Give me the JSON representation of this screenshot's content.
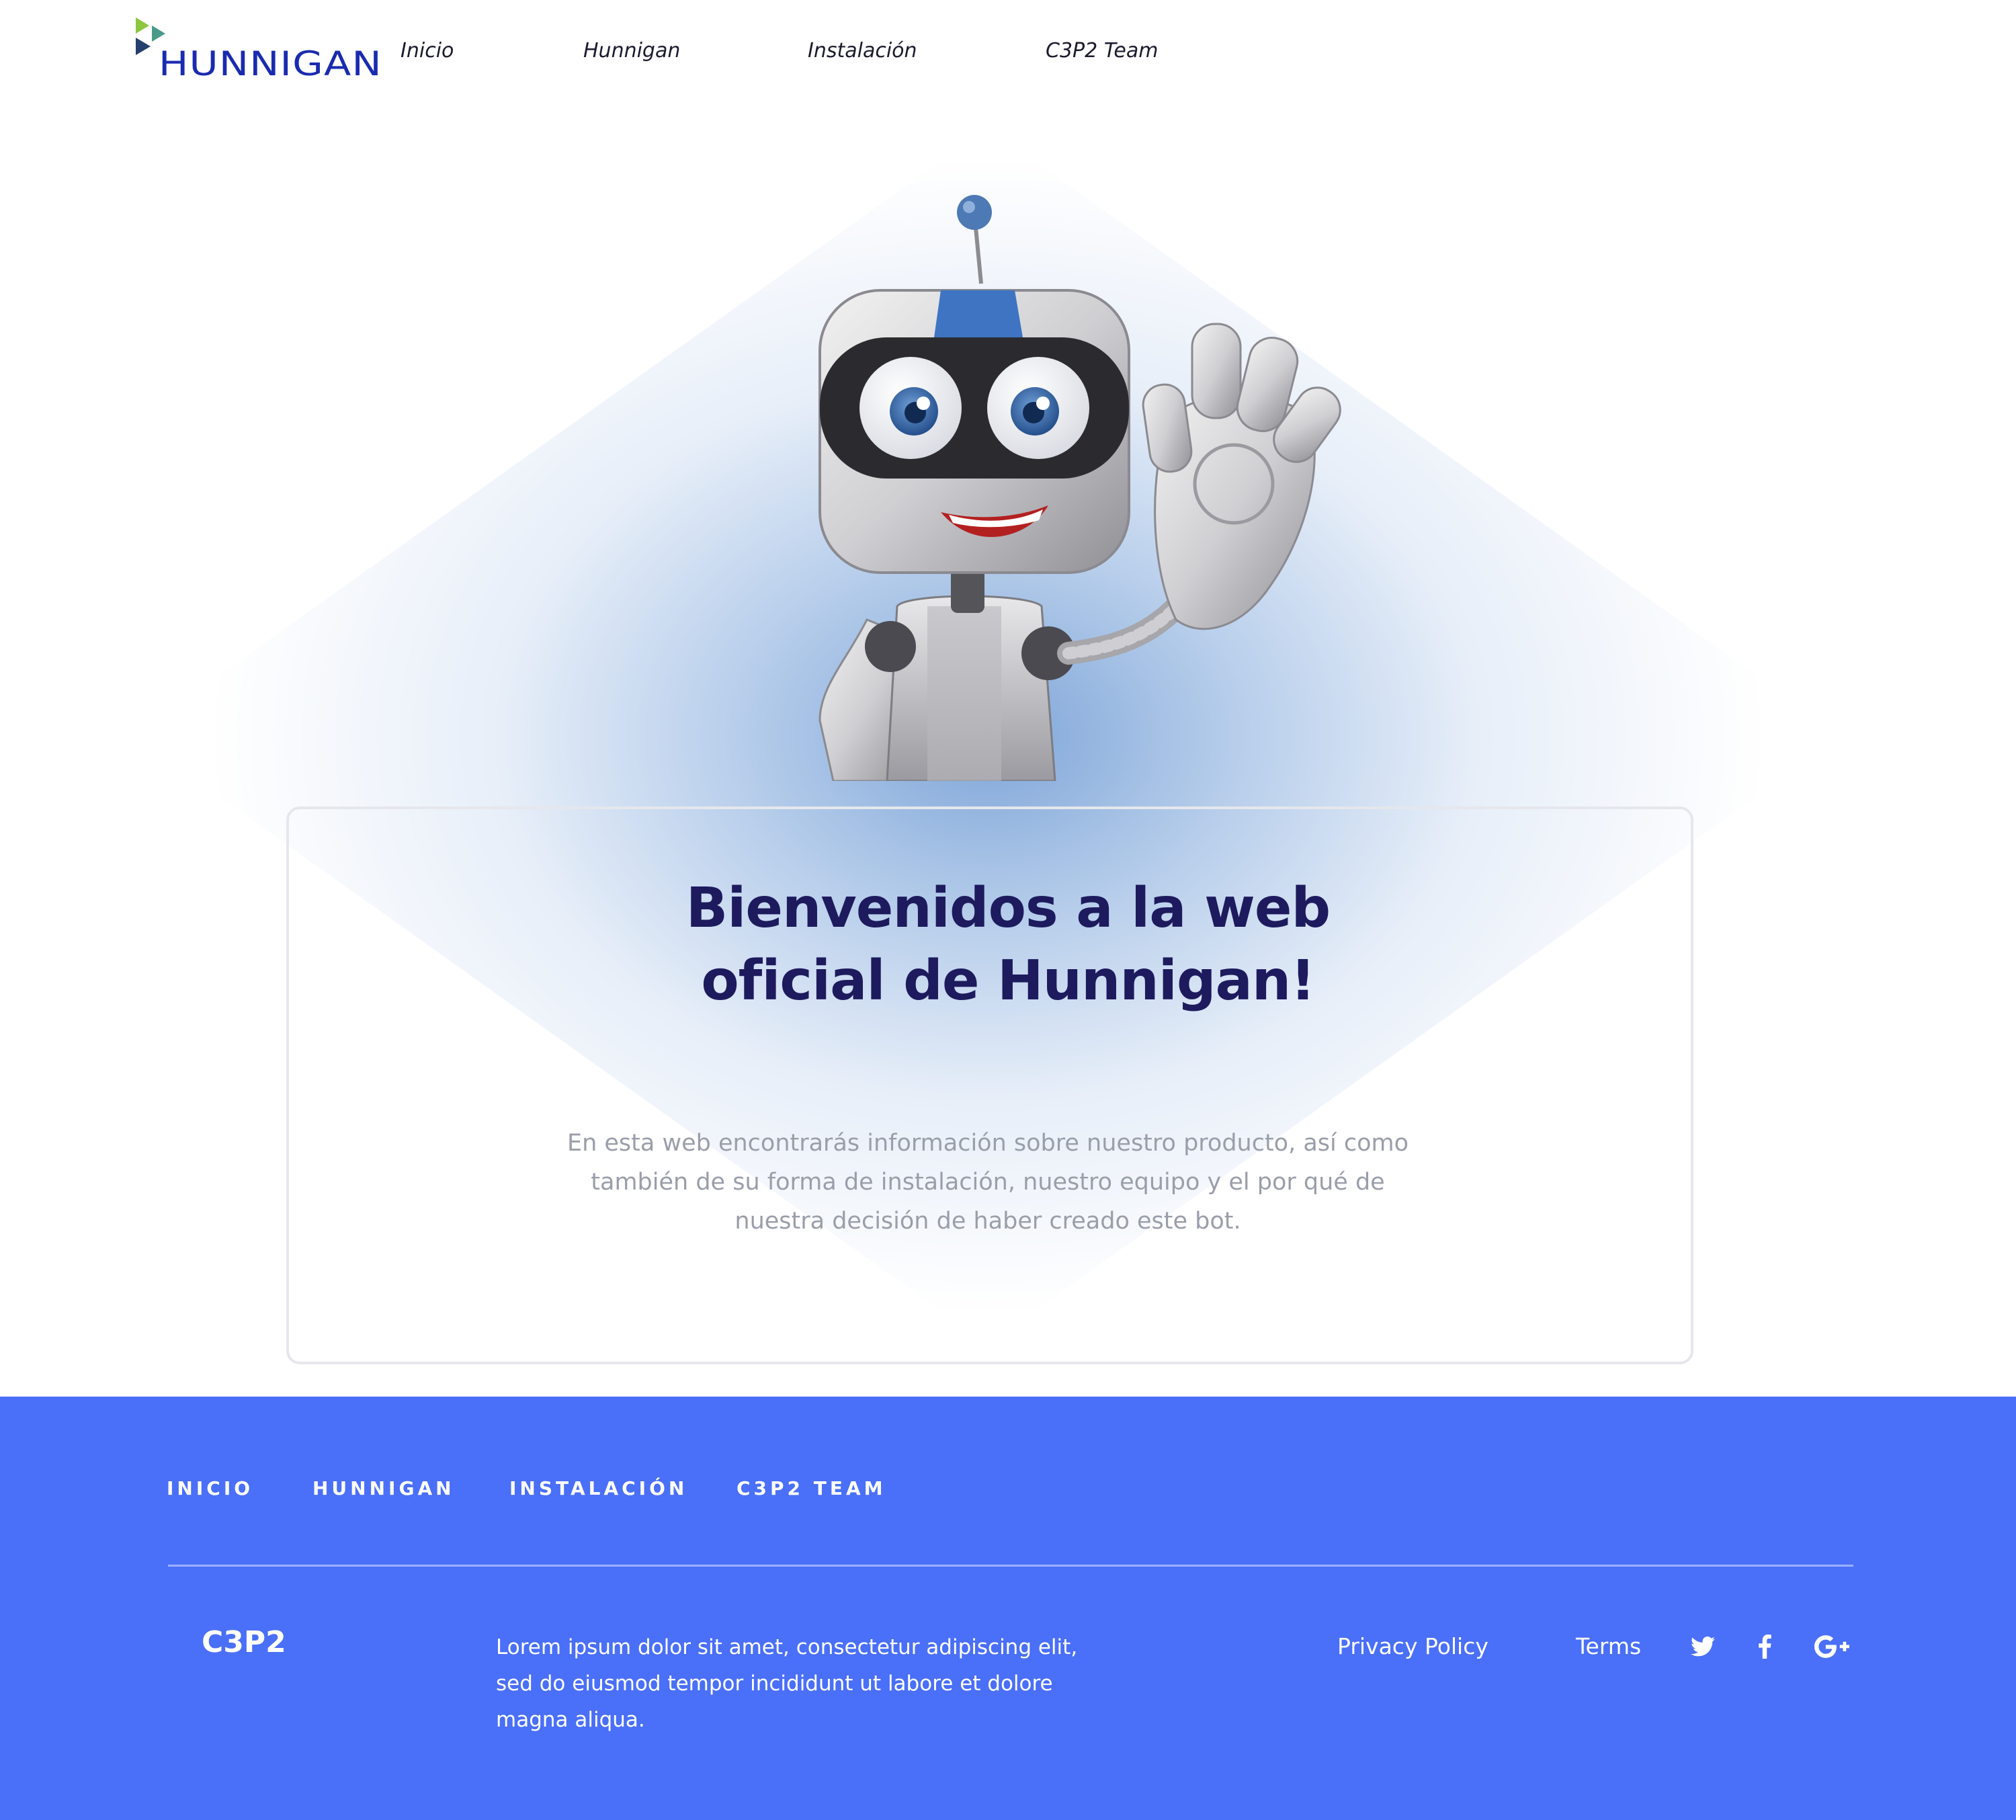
{
  "header": {
    "logo_text": "HUNNIGAN",
    "nav": [
      "Inicio",
      "Hunnigan",
      "Instalación",
      "C3P2 Team"
    ]
  },
  "hero": {
    "title_line1": "Bienvenidos a la web",
    "title_line2": "oficial de Hunnigan!",
    "description": "En esta web encontrarás información sobre nuestro producto, así como también de su forma de instalación, nuestro equipo y el por qué de nuestra decisión de haber creado este bot."
  },
  "footer": {
    "nav": [
      "INICIO",
      "HUNNIGAN",
      "INSTALACIÓN",
      "C3P2 TEAM"
    ],
    "brand": "C3P2",
    "text": "Lorem ipsum dolor sit amet, consectetur adipiscing elit, sed do eiusmod tempor incididunt ut labore et dolore magna aliqua.",
    "privacy": "Privacy Policy",
    "terms": "Terms",
    "social_icons": [
      "twitter-icon",
      "facebook-icon",
      "google-plus-icon"
    ]
  },
  "colors": {
    "logo_blue": "#1a2bb0",
    "logo_green": "#8dc63f",
    "title": "#1d1a5e",
    "description": "#9a9eaa",
    "footer_bg": "#4a6ff8",
    "glow": "#7ea6d8"
  }
}
